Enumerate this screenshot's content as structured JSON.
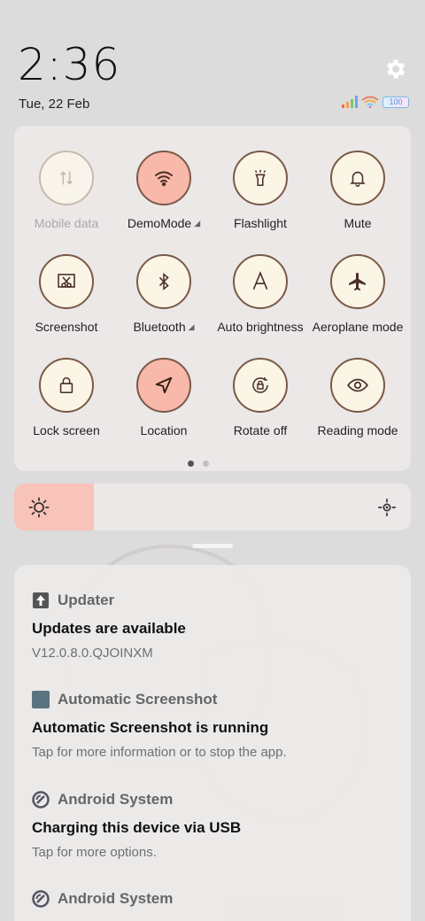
{
  "status": {
    "time": "2:36",
    "date": "Tue, 22 Feb",
    "battery": "100"
  },
  "quick_settings": {
    "tiles": [
      {
        "label": "Mobile data",
        "icon": "mobile-data-icon",
        "state": "disabled",
        "arrow": false
      },
      {
        "label": "DemoMode",
        "icon": "wifi-icon",
        "state": "on",
        "arrow": true
      },
      {
        "label": "Flashlight",
        "icon": "flashlight-icon",
        "state": "off",
        "arrow": false
      },
      {
        "label": "Mute",
        "icon": "bell-icon",
        "state": "off",
        "arrow": false
      },
      {
        "label": "Screenshot",
        "icon": "screenshot-icon",
        "state": "off",
        "arrow": false
      },
      {
        "label": "Bluetooth",
        "icon": "bluetooth-icon",
        "state": "off",
        "arrow": true
      },
      {
        "label": "Auto brightness",
        "icon": "auto-brightness-icon",
        "state": "off",
        "arrow": false
      },
      {
        "label": "Aeroplane mode",
        "icon": "airplane-icon",
        "state": "off",
        "arrow": false
      },
      {
        "label": "Lock screen",
        "icon": "lock-icon",
        "state": "off",
        "arrow": false
      },
      {
        "label": "Location",
        "icon": "location-icon",
        "state": "on",
        "arrow": false
      },
      {
        "label": "Rotate off",
        "icon": "rotate-lock-icon",
        "state": "off",
        "arrow": false
      },
      {
        "label": "Reading mode",
        "icon": "eye-icon",
        "state": "off",
        "arrow": false
      }
    ],
    "pages": 2,
    "active_page": 0
  },
  "brightness": {
    "level_fraction": 0.2
  },
  "notifications": [
    {
      "app": "Updater",
      "icon": "update-arrow-icon",
      "title": "Updates are available",
      "text": "V12.0.8.0.QJOINXM"
    },
    {
      "app": "Automatic Screenshot",
      "icon": "screenshot-app-icon",
      "title": "Automatic Screenshot is running",
      "text": "Tap for more information or to stop the app."
    },
    {
      "app": "Android System",
      "icon": "android-system-icon",
      "title": "Charging this device via USB",
      "text": "Tap for more options."
    },
    {
      "app": "Android System",
      "icon": "android-system-icon",
      "title": "",
      "text": ""
    }
  ],
  "colors": {
    "tile_on": "#f8b8aa",
    "tile_off": "#fbf5e6",
    "tile_border": "#7a5a48",
    "panel_bg": "#ebe8e7"
  }
}
